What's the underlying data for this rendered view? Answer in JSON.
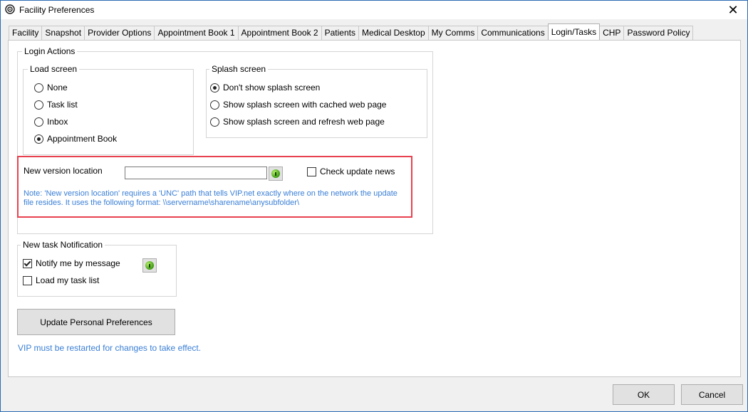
{
  "window": {
    "title": "Facility Preferences",
    "close_glyph": "✕"
  },
  "tabs": [
    {
      "label": "Facility"
    },
    {
      "label": "Snapshot"
    },
    {
      "label": "Provider Options"
    },
    {
      "label": "Appointment Book 1"
    },
    {
      "label": "Appointment Book 2"
    },
    {
      "label": "Patients"
    },
    {
      "label": "Medical Desktop"
    },
    {
      "label": "My Comms"
    },
    {
      "label": "Communications"
    },
    {
      "label": "Login/Tasks",
      "active": true
    },
    {
      "label": "CHP"
    },
    {
      "label": "Password Policy"
    }
  ],
  "login_actions": {
    "legend": "Login Actions",
    "load_screen": {
      "legend": "Load screen",
      "options": [
        {
          "label": "None",
          "selected": false
        },
        {
          "label": "Task list",
          "selected": false
        },
        {
          "label": "Inbox",
          "selected": false
        },
        {
          "label": "Appointment Book",
          "selected": true
        }
      ]
    },
    "splash_screen": {
      "legend": "Splash screen",
      "options": [
        {
          "label": "Don't show splash screen",
          "selected": true
        },
        {
          "label": "Show splash screen with cached web page",
          "selected": false
        },
        {
          "label": "Show splash screen and refresh web page",
          "selected": false
        }
      ]
    },
    "new_version": {
      "label": "New version location",
      "value": "",
      "check_update_news": {
        "label": "Check update news",
        "checked": false
      },
      "note_line1": "Note: 'New version location' requires a 'UNC' path that tells VIP.net exactly where on the network the update",
      "note_line2": "file resides. It uses the following format:  \\\\servername\\sharename\\anysubfolder\\"
    }
  },
  "new_task_notification": {
    "legend": "New task Notification",
    "notify_by_message": {
      "label": "Notify me by message",
      "checked": true
    },
    "load_task_list": {
      "label": "Load my task list",
      "checked": false
    }
  },
  "update_button": "Update Personal Preferences",
  "restart_note": "VIP must be restarted for changes to take effect.",
  "footer": {
    "ok": "OK",
    "cancel": "Cancel"
  },
  "colors": {
    "note_blue": "#3a7fd6",
    "highlight_red": "#e8414f",
    "info_icon_green": "#3d9b12"
  }
}
